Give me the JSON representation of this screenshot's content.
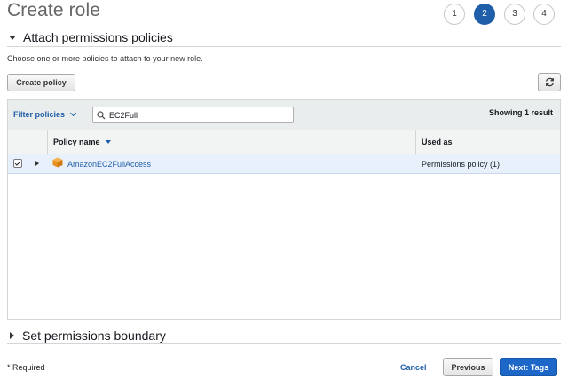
{
  "header": {
    "title": "Create role",
    "steps": [
      "1",
      "2",
      "3",
      "4"
    ],
    "active_step": "2"
  },
  "attach_section": {
    "title": "Attach permissions policies",
    "description": "Choose one or more policies to attach to your new role.",
    "create_policy_label": "Create policy"
  },
  "filter": {
    "label": "Filter policies",
    "search_value": "EC2Full",
    "showing": "Showing 1 result"
  },
  "table": {
    "columns": [
      "Policy name",
      "Used as"
    ],
    "rows": [
      {
        "checked": true,
        "name": "AmazonEC2FullAccess",
        "used_as": "Permissions policy (1)"
      }
    ]
  },
  "boundary_section": {
    "title": "Set permissions boundary"
  },
  "footer": {
    "required": "* Required",
    "cancel": "Cancel",
    "previous": "Previous",
    "next": "Next: Tags"
  },
  "colors": {
    "link": "#1f5ea8",
    "primary_button": "#1d67c8",
    "selected_row": "#e8f1fb",
    "policy_icon": "#f0a030"
  },
  "icons": {
    "refresh": "refresh-icon",
    "search": "search-icon",
    "policy": "policy-cube-icon"
  }
}
